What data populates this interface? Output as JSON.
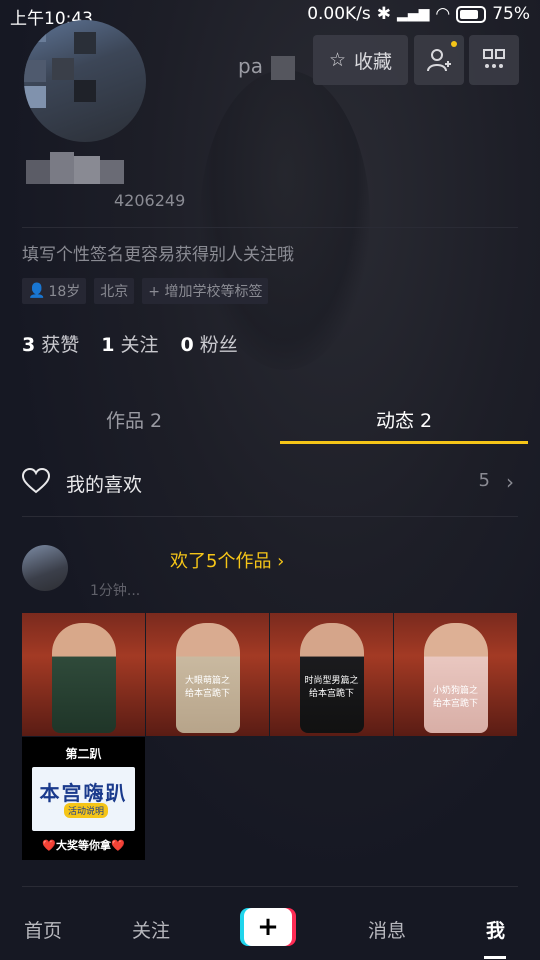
{
  "status_bar": {
    "time": "上午10:43",
    "network_speed": "0.00K/s",
    "battery": "75%"
  },
  "profile": {
    "nickname_visible": "pa",
    "uid_suffix": "4206249",
    "bio": "填写个性签名更容易获得别人关注哦",
    "tags": [
      "18岁",
      "北京",
      "+ 增加学校等标签"
    ],
    "stats": [
      {
        "count": "3",
        "label": "获赞"
      },
      {
        "count": "1",
        "label": "关注"
      },
      {
        "count": "0",
        "label": "粉丝"
      }
    ]
  },
  "top_actions": {
    "favorite_label": "收藏"
  },
  "tabs": [
    {
      "label": "作品 2"
    },
    {
      "label": "动态 2"
    }
  ],
  "likes_row": {
    "label": "我的喜欢",
    "count": "5",
    "chevron": "›"
  },
  "activity": {
    "text": "欢了5个作品 ›",
    "sub": "1分钟..."
  },
  "thumbnails": [
    {
      "caption": ""
    },
    {
      "caption": "大眼萌篇之\n给本宫跪下"
    },
    {
      "caption": "时尚型男篇之\n给本宫跪下"
    },
    {
      "caption": "小奶狗篇之\n给本宫跪下"
    }
  ],
  "poster": {
    "title": "第二趴",
    "big_text": "本宫嗨趴",
    "pill": "活动说明",
    "bottom": "❤️大奖等你拿❤️"
  },
  "bottom_nav": {
    "home": "首页",
    "follow": "关注",
    "plus": "+",
    "messages": "消息",
    "me": "我"
  },
  "peek_text": "paddy",
  "colors": {
    "background": "#161823",
    "accent_yellow": "#f5c518",
    "tiktok_cyan": "#20d5ec",
    "tiktok_red": "#fe2c55"
  }
}
